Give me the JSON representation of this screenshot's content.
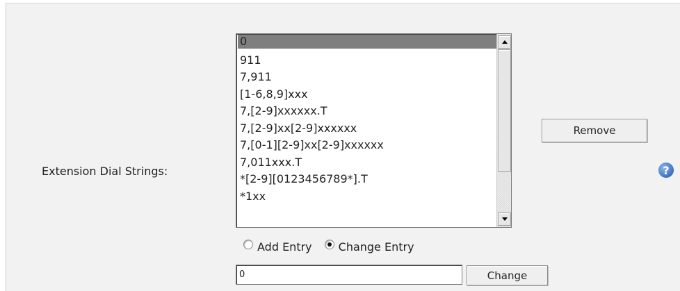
{
  "field": {
    "label": "Extension Dial Strings:"
  },
  "dial_strings": {
    "items": [
      "0",
      "911",
      "7,911",
      "[1-6,8,9]xxx",
      "7,[2-9]xxxxxx.T",
      "7,[2-9]xx[2-9]xxxxxx",
      "7,[0-1][2-9]xx[2-9]xxxxxx",
      "7,011xxx.T",
      "*[2-9][0123456789*].T",
      "*1xx"
    ],
    "selected": "0"
  },
  "buttons": {
    "remove_label": "Remove",
    "change_label": "Change"
  },
  "mode": {
    "add_label": "Add Entry",
    "change_label": "Change Entry",
    "selected": "Change Entry"
  },
  "entry": {
    "value": "0"
  },
  "help": {
    "glyph": "?",
    "icon": "help-icon"
  },
  "colors": {
    "panel_bg": "#f2f2f2",
    "selected_row": "#7f7f7f",
    "help_icon": "#3d6fbf"
  }
}
